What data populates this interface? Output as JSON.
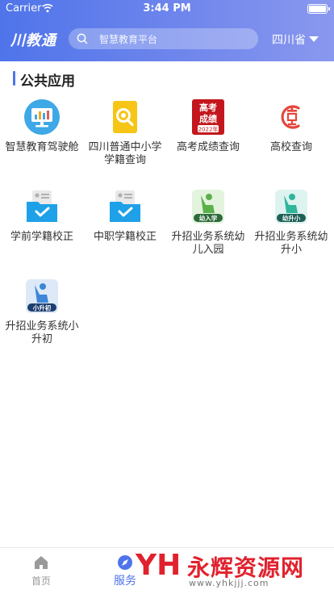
{
  "status_bar": {
    "carrier": "Carrier",
    "time": "3:44 PM"
  },
  "header": {
    "logo": "川教通",
    "search_placeholder": "智慧教育平台",
    "region": "四川省"
  },
  "section": {
    "title": "公共应用"
  },
  "apps": [
    {
      "label": "智慧教育驾驶舱",
      "icon": "dashboard-monitor-icon"
    },
    {
      "label": "四川普通中小学学籍查询",
      "icon": "student-record-search-icon"
    },
    {
      "label": "高考成绩查询",
      "icon": "gaokao-score-icon",
      "icon_text": [
        "高考",
        "成绩",
        "2022年"
      ]
    },
    {
      "label": "高校查询",
      "icon": "university-search-icon"
    },
    {
      "label": "学前学籍校正",
      "icon": "preschool-record-folder-icon"
    },
    {
      "label": "中职学籍校正",
      "icon": "vocational-record-folder-icon"
    },
    {
      "label": "升招业务系统幼儿入园",
      "icon": "kindergarten-enroll-icon",
      "icon_text": "幼入学"
    },
    {
      "label": "升招业务系统幼升小",
      "icon": "kindergarten-to-primary-icon",
      "icon_text": "幼升小"
    },
    {
      "label": "升招业务系统小升初",
      "icon": "primary-to-middle-icon",
      "icon_text": "小升初"
    }
  ],
  "tabbar": {
    "home_label": "首页",
    "service_label": "服务"
  },
  "watermark": {
    "logo": "YH",
    "name": "永辉资源网",
    "url": "www.yhkjjj.com"
  },
  "colors": {
    "primary": "#4f74ea",
    "accent_red": "#e0222e",
    "tab_active": "#4f74ea",
    "tab_inactive": "#999999"
  }
}
